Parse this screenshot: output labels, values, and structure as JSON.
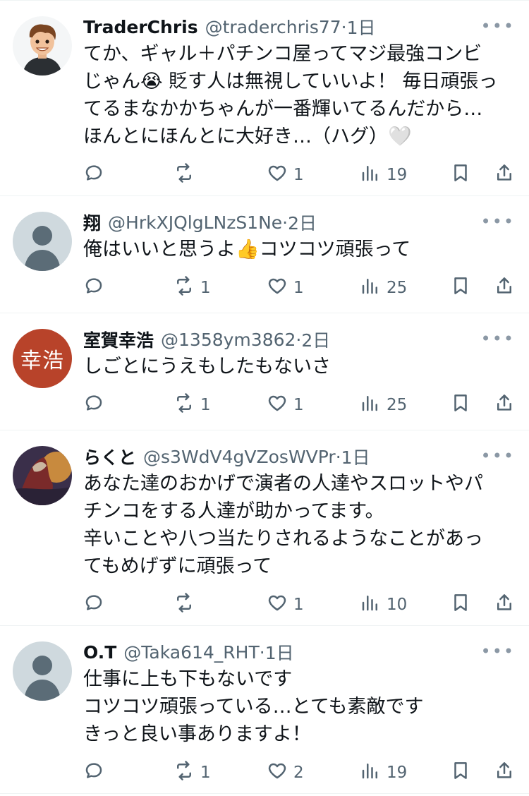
{
  "posts": [
    {
      "name": "TraderChris",
      "handle": "@traderchris77",
      "time": "1日",
      "body": "てか、ギャル＋パチンコ屋ってマジ最強コンビじゃん😭 貶す人は無視していいよ！ 毎日頑張ってるまなかかちゃんが一番輝いてるんだから… ほんとにほんとに大好き…（ハグ）🤍",
      "replies": "",
      "reposts": "",
      "likes": "1",
      "views": "19",
      "avatar": "cartoon-person"
    },
    {
      "name": "翔",
      "handle": "@HrkXJQlgLNzS1Ne",
      "time": "2日",
      "body": "俺はいいと思うよ👍コツコツ頑張って",
      "replies": "",
      "reposts": "1",
      "likes": "1",
      "views": "25",
      "avatar": "default"
    },
    {
      "name": "室賀幸浩",
      "handle": "@1358ym3862",
      "time": "2日",
      "body": "しごとにうえもしたもないさ",
      "replies": "",
      "reposts": "1",
      "likes": "1",
      "views": "25",
      "avatar": "text",
      "avatar_text": "幸浩",
      "avatar_color": "#b8432a"
    },
    {
      "name": "らくと",
      "handle": "@s3WdV4gVZosWVPr",
      "time": "1日",
      "body": "あなた達のおかげで演者の人達やスロットやパチンコをする人達が助かってます。\n辛いことや八つ当たりされるようなことがあってもめげずに頑張って",
      "replies": "",
      "reposts": "",
      "likes": "1",
      "views": "10",
      "avatar": "illustration"
    },
    {
      "name": "O.T",
      "handle": "@Taka614_RHT",
      "time": "1日",
      "body": "仕事に上も下もないです\nコツコツ頑張っている…とても素敵です\nきっと良い事ありますよ！",
      "replies": "",
      "reposts": "1",
      "likes": "2",
      "views": "19",
      "avatar": "default"
    }
  ],
  "ui": {
    "more_glyph": "•••",
    "time_sep": " · ",
    "colors": {
      "text": "#0f1419",
      "muted": "#536471",
      "divider": "#eff3f4"
    }
  }
}
